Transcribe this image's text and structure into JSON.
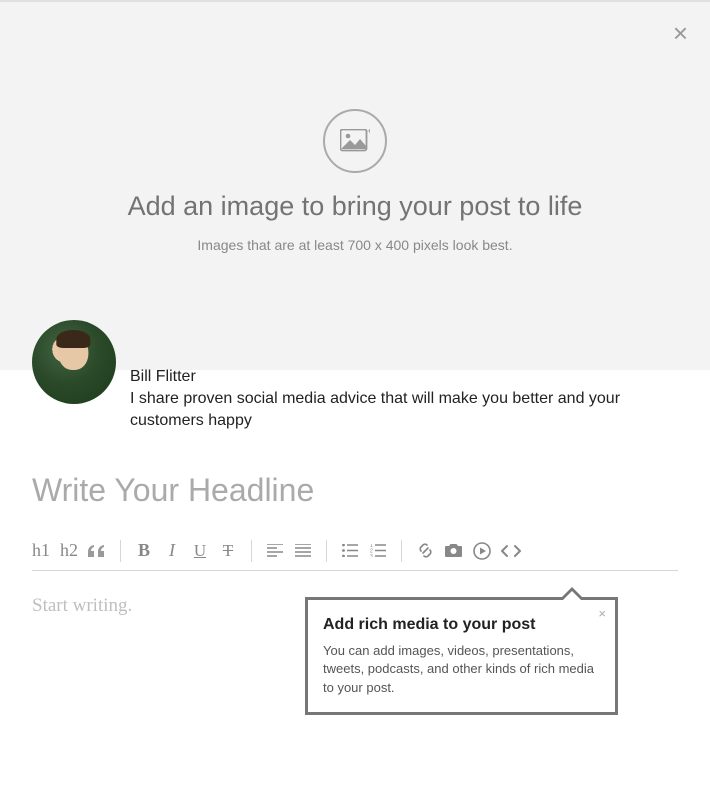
{
  "hero": {
    "title": "Add an image to bring your post to life",
    "subtitle": "Images that are at least 700 x 400 pixels look best."
  },
  "author": {
    "name": "Bill Flitter",
    "bio": "I share proven social media advice that will make you better and your customers happy"
  },
  "headline": {
    "placeholder": "Write Your Headline"
  },
  "toolbar": {
    "h1": "h1",
    "h2": "h2",
    "quote": "““",
    "bold": "B",
    "italic": "I",
    "underline": "U",
    "strike": "T"
  },
  "body": {
    "placeholder": "Start writing."
  },
  "popover": {
    "title": "Add rich media to your post",
    "body": "You can add images, videos, presentations, tweets, podcasts, and other kinds of rich media to your post."
  }
}
